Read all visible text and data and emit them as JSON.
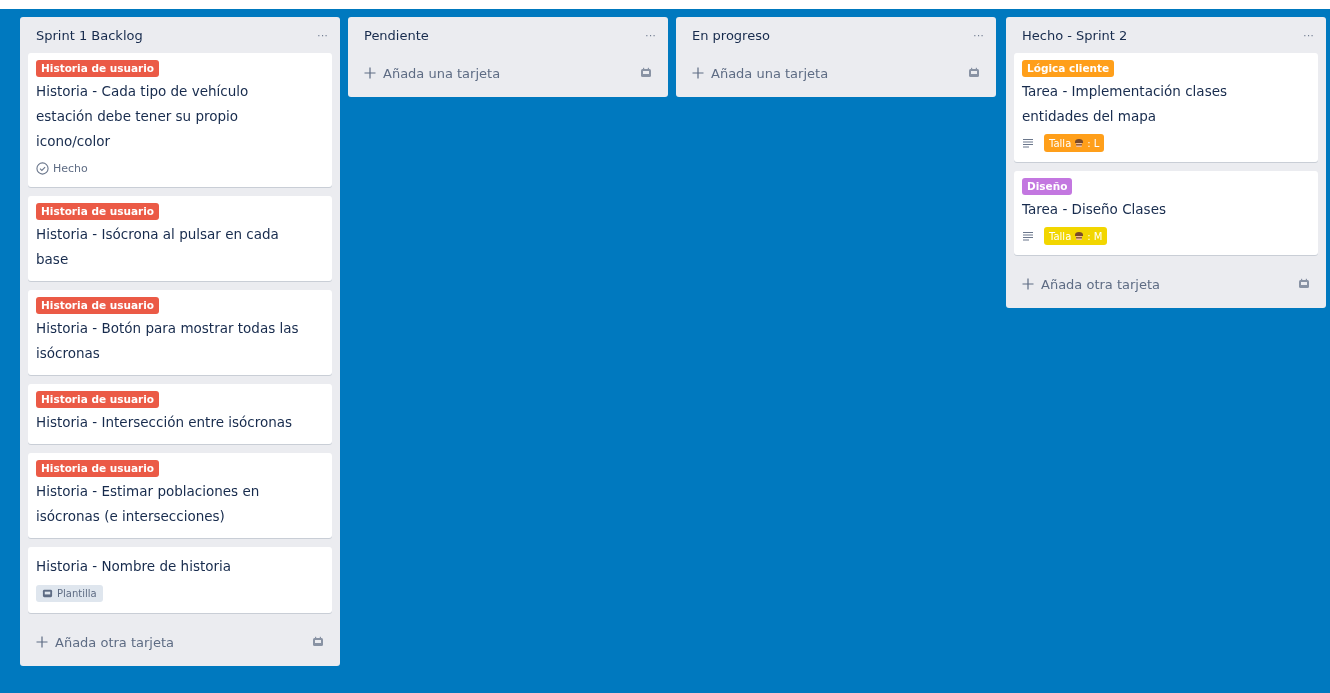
{
  "lists": [
    {
      "title": "Sprint 1 Backlog",
      "menu": "···",
      "cards": [
        {
          "labels": [
            {
              "text": "Historia de usuario",
              "color": "#eb5a46"
            }
          ],
          "title": "Historia - Cada tipo de vehículo estación debe tener su propio icono/color",
          "badges": [
            {
              "kind": "done",
              "text": "Hecho"
            }
          ]
        },
        {
          "labels": [
            {
              "text": "Historia de usuario",
              "color": "#eb5a46"
            }
          ],
          "title": "Historia - Isócrona al pulsar en cada base"
        },
        {
          "labels": [
            {
              "text": "Historia de usuario",
              "color": "#eb5a46"
            }
          ],
          "title": "Historia - Botón para mostrar todas las isócronas"
        },
        {
          "labels": [
            {
              "text": "Historia de usuario",
              "color": "#eb5a46"
            }
          ],
          "title": "Historia - Intersección entre isócronas"
        },
        {
          "labels": [
            {
              "text": "Historia de usuario",
              "color": "#eb5a46"
            }
          ],
          "title": "Historia - Estimar poblaciones en isócronas (e intersecciones)"
        },
        {
          "title": "Historia - Nombre de historia",
          "badges": [
            {
              "kind": "template",
              "text": "Plantilla"
            }
          ]
        }
      ],
      "add": "Añada otra tarjeta"
    },
    {
      "title": "Pendiente",
      "menu": "···",
      "add": "Añada una tarjeta"
    },
    {
      "title": "En progreso",
      "menu": "···",
      "add": "Añada una tarjeta"
    },
    {
      "title": "Hecho - Sprint 2",
      "menu": "···",
      "cards": [
        {
          "labels": [
            {
              "text": "Lógica cliente",
              "color": "#ff9f1a"
            }
          ],
          "title": "Tarea - Implementación clases entidades del mapa",
          "badges": [
            {
              "kind": "description"
            },
            {
              "kind": "size",
              "text": "Talla",
              "value": ": L",
              "color": "#ff9f1a"
            }
          ]
        },
        {
          "labels": [
            {
              "text": "Diseño",
              "color": "#c377e0"
            }
          ],
          "title": "Tarea - Diseño Clases",
          "badges": [
            {
              "kind": "description"
            },
            {
              "kind": "size",
              "text": "Talla",
              "value": ": M",
              "color": "#f2d600"
            }
          ]
        }
      ],
      "add": "Añada otra tarjeta"
    }
  ]
}
